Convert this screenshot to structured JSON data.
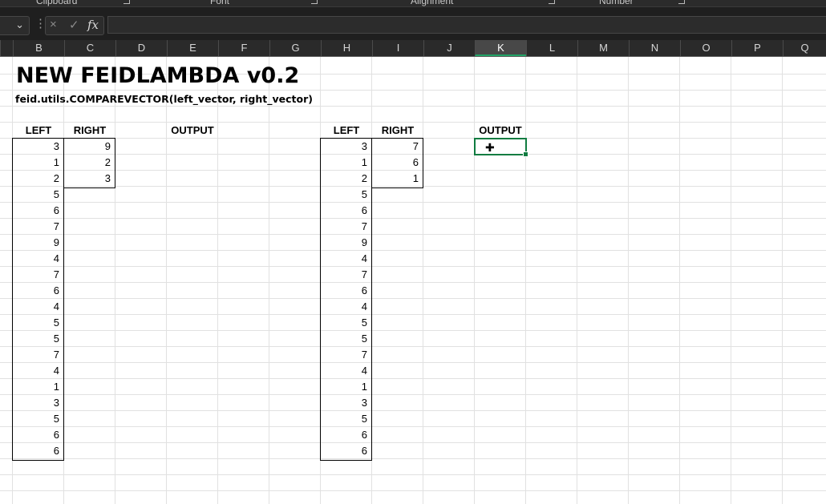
{
  "ribbon": {
    "groups": [
      "Clipboard",
      "Font",
      "Alignment",
      "Number"
    ]
  },
  "formula_bar": {
    "name_box": "",
    "cancel_icon": "×",
    "enter_icon": "✓",
    "fx_label": "fx",
    "value": ""
  },
  "columns": [
    "B",
    "C",
    "D",
    "E",
    "F",
    "G",
    "H",
    "I",
    "J",
    "K",
    "L",
    "M",
    "N",
    "O",
    "P",
    "Q"
  ],
  "selected_column": "K",
  "sheet": {
    "title": "NEW FEIDLAMBDA v0.2",
    "formula_text": "feid.utils.COMPAREVECTOR(left_vector, right_vector)",
    "left_table": {
      "left_header": "LEFT",
      "right_header": "RIGHT",
      "output_header": "OUTPUT",
      "left_values": [
        "3",
        "1",
        "2",
        "5",
        "6",
        "7",
        "9",
        "4",
        "7",
        "6",
        "4",
        "5",
        "5",
        "7",
        "4",
        "1",
        "3",
        "5",
        "6",
        "6"
      ],
      "right_values": [
        "9",
        "2",
        "3"
      ]
    },
    "right_table": {
      "left_header": "LEFT",
      "right_header": "RIGHT",
      "output_header": "OUTPUT",
      "left_values": [
        "3",
        "1",
        "2",
        "5",
        "6",
        "7",
        "9",
        "4",
        "7",
        "6",
        "4",
        "5",
        "5",
        "7",
        "4",
        "1",
        "3",
        "5",
        "6",
        "6"
      ],
      "right_values": [
        "7",
        "6",
        "1"
      ]
    }
  },
  "colors": {
    "accent": "#107c41",
    "header_bg": "#2a2a2a",
    "ribbon_bg": "#1f1f1f"
  }
}
